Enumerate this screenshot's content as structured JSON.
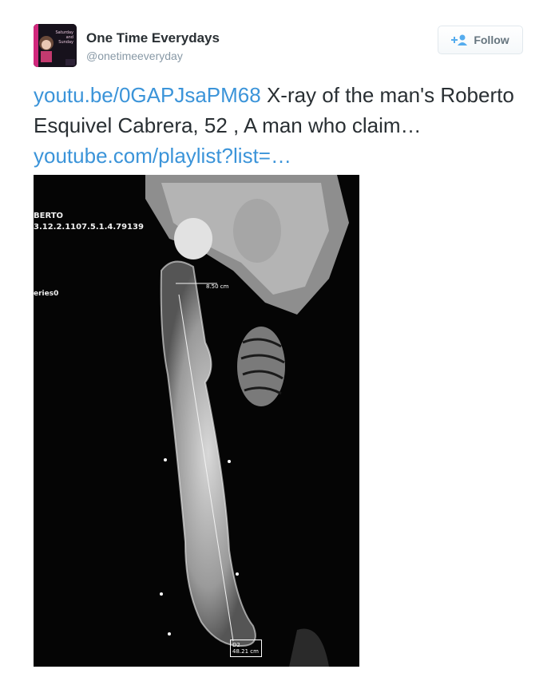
{
  "header": {
    "display_name": "One Time Everydays",
    "handle": "@onetimeeveryday",
    "avatar_text": [
      "Saturday",
      "and",
      "Sunday"
    ],
    "follow_label": "Follow"
  },
  "tweet": {
    "link1": "youtu.be/0GAPJsaPM68",
    "text1": " X-ray of the man's Roberto Esquivel Cabrera, 52 , A man who claim… ",
    "link2": "youtube.com/playlist?list=…"
  },
  "media": {
    "overlay_name": "BERTO",
    "overlay_id": "3.12.2.1107.5.1.4.79139",
    "overlay_series": "eries0",
    "measure_small": "8.50 cm",
    "measure_box_line1": "D2",
    "measure_box_line2": "48.21 cm"
  },
  "colors": {
    "link": "#3b94d9",
    "text": "#292f33",
    "muted": "#8899a6"
  }
}
